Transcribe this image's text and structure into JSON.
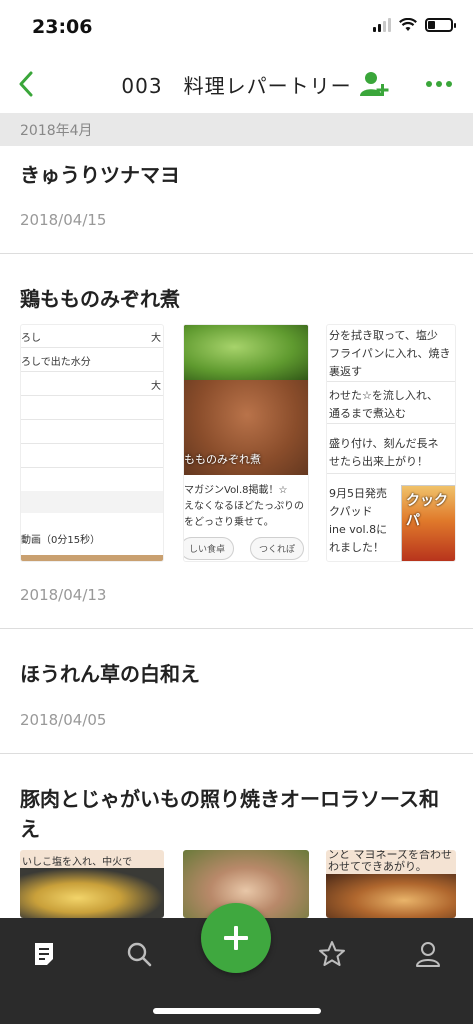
{
  "status_bar": {
    "time": "23:06"
  },
  "nav": {
    "title": "003　料理レパートリー",
    "accent": "#3aa63a"
  },
  "section": {
    "label": "2018年4月"
  },
  "entries": [
    {
      "title": "きゅうりツナマヨ",
      "date": "2018/04/15"
    },
    {
      "title": "鶏もものみぞれ煮",
      "date": "2018/04/13",
      "doc1": {
        "rows": [
          "ろし",
          "ろしで出た水分",
          "",
          "",
          "",
          ""
        ],
        "col2": [
          "大",
          "",
          "大",
          "",
          "",
          ""
        ],
        "video": "動画（0分15秒）"
      },
      "photo": {
        "caption": "もものみぞれ煮",
        "text1": "マガジンVol.8掲載！☆",
        "text2": "えなくなるほどたっぷりの",
        "text3": "をどっさり乗せて。",
        "pill1": "しい食卓",
        "pill2": "つくれぽ"
      },
      "doc2": {
        "rows": [
          "分を拭き取って、塩少",
          "フライパンに入れ、焼き",
          "裏返す",
          "わせた☆を流し入れ、",
          "通るまで煮込む",
          "盛り付け、刻んだ長ネ",
          "せたら出来上がり！",
          "9月5日発売",
          "クパッド",
          "ine vol.8に",
          "れました！"
        ],
        "magazine": "クックパ"
      }
    },
    {
      "title": "ほうれん草の白和え",
      "date": "2018/04/05"
    },
    {
      "title": "豚肉とじゃがいもの照り焼きオーロラソース和え",
      "thumb_text1": "いしこ塩を入れ、中火で",
      "thumb_text2": "ンと マヨネーズを合わせ",
      "thumb_text3": "わせてできあがり。"
    }
  ]
}
